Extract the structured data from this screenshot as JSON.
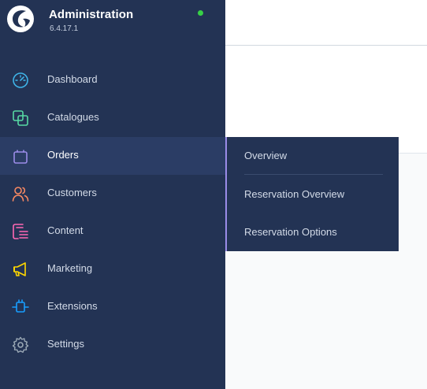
{
  "app": {
    "title": "Administration",
    "version": "6.4.17.1",
    "status_color": "#37d046"
  },
  "nav": {
    "items": [
      {
        "label": "Dashboard",
        "icon": "gauge-icon",
        "color": "#3fb4e8"
      },
      {
        "label": "Catalogues",
        "icon": "catalogue-icon",
        "color": "#57d9a3"
      },
      {
        "label": "Orders",
        "icon": "shopping-bag-icon",
        "color": "#9b8ce8",
        "active": true
      },
      {
        "label": "Customers",
        "icon": "users-icon",
        "color": "#f88962"
      },
      {
        "label": "Content",
        "icon": "content-icon",
        "color": "#ff68b4"
      },
      {
        "label": "Marketing",
        "icon": "megaphone-icon",
        "color": "#ffd700"
      },
      {
        "label": "Extensions",
        "icon": "plug-icon",
        "color": "#189eff"
      },
      {
        "label": "Settings",
        "icon": "gear-icon",
        "color": "#9aa8b5"
      }
    ]
  },
  "flyout": {
    "items": [
      {
        "label": "Overview"
      },
      {
        "label": "Reservation Overview"
      },
      {
        "label": "Reservation Options"
      }
    ]
  }
}
